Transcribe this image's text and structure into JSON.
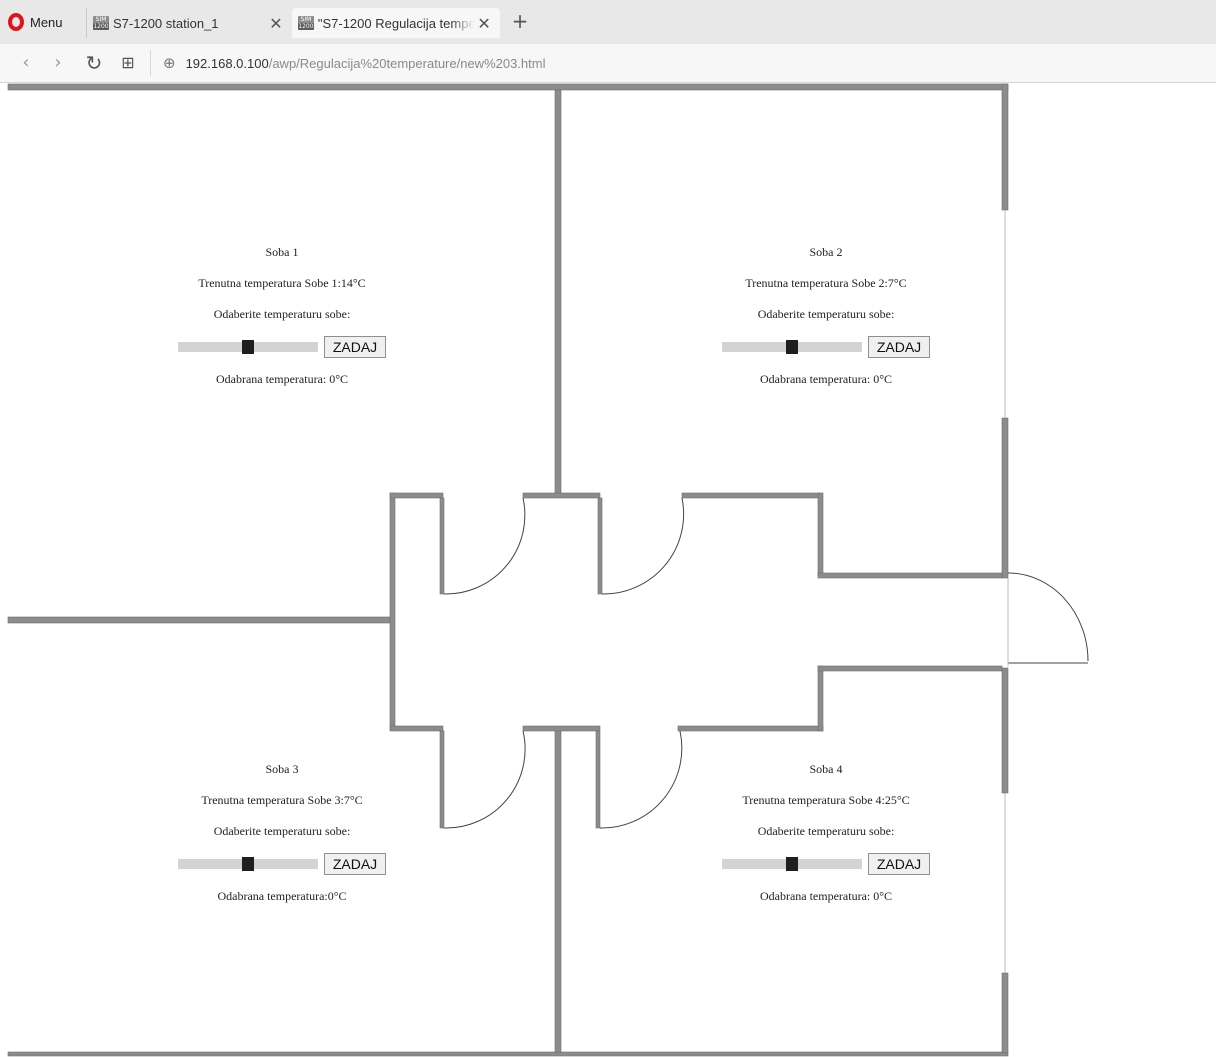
{
  "browser": {
    "menu_label": "Menu",
    "tabs": [
      {
        "title": "S7-1200 station_1",
        "favicon_text": "SIM 1200",
        "active": false
      },
      {
        "title": "\"S7-1200 Regulacija tempe",
        "favicon_text": "SIM 1200",
        "active": true
      }
    ],
    "url": {
      "host": "192.168.0.100",
      "path": "/awp/Regulacija%20temperature/new%203.html"
    },
    "icons": {
      "menu": "opera-logo-icon",
      "tab_close": "close-icon",
      "new_tab": "plus-icon",
      "back": "chevron-left-icon",
      "forward": "chevron-right-icon",
      "reload": "reload-icon",
      "speed_dial": "grid-icon",
      "site_info": "globe-icon"
    }
  },
  "rooms": [
    {
      "title": "Soba 1",
      "current_temp": "Trenutna temperatura Sobe 1:14°C",
      "prompt": "Odaberite temperaturu sobe:",
      "button_label": "ZADAJ",
      "selected": "Odabrana temperatura: 0°C",
      "slider_value": 0.5
    },
    {
      "title": "Soba 2",
      "current_temp": "Trenutna temperatura Sobe 2:7°C",
      "prompt": "Odaberite temperaturu sobe:",
      "button_label": "ZADAJ",
      "selected": "Odabrana temperatura: 0°C",
      "slider_value": 0.5
    },
    {
      "title": "Soba 3",
      "current_temp": "Trenutna temperatura Sobe 3:7°C",
      "prompt": "Odaberite temperaturu sobe:",
      "button_label": "ZADAJ",
      "selected": "Odabrana temperatura:0°C",
      "slider_value": 0.5
    },
    {
      "title": "Soba 4",
      "current_temp": "Trenutna temperatura Sobe 4:25°C",
      "prompt": "Odaberite temperaturu sobe:",
      "button_label": "ZADAJ",
      "selected": "Odabrana temperatura: 0°C",
      "slider_value": 0.5
    }
  ],
  "colors": {
    "wall": "#8c8c8c",
    "wall_edge": "#6e6e6e",
    "slider_track": "#d3d3d3",
    "slider_thumb": "#1e1e1e",
    "accent_opera": "#e0141e"
  }
}
